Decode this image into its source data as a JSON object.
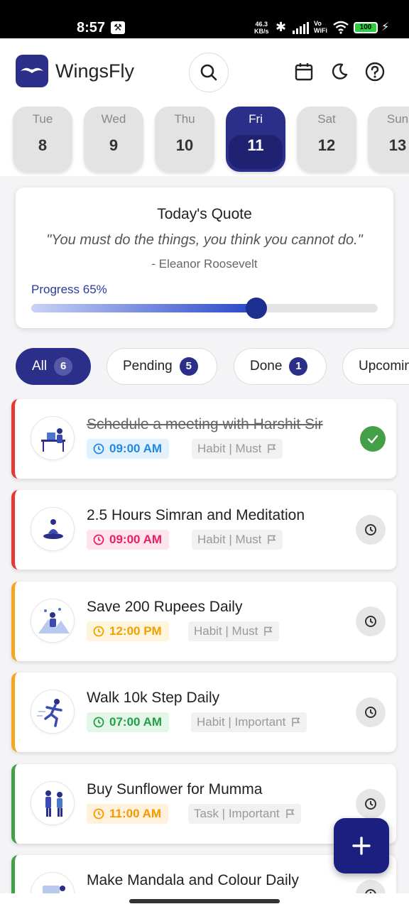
{
  "status_bar": {
    "time": "8:57",
    "speed_value": "46.3",
    "speed_unit": "KB/s",
    "vo": "Vo",
    "wifi_label": "WiFi",
    "battery": "100"
  },
  "header": {
    "app_name": "WingsFly"
  },
  "days": [
    {
      "name": "Tue",
      "num": "8"
    },
    {
      "name": "Wed",
      "num": "9"
    },
    {
      "name": "Thu",
      "num": "10"
    },
    {
      "name": "Fri",
      "num": "11",
      "active": true
    },
    {
      "name": "Sat",
      "num": "12"
    },
    {
      "name": "Sun",
      "num": "13"
    }
  ],
  "quote": {
    "title": "Today's Quote",
    "text": "\"You must do the things, you think you cannot do.\"",
    "author": "- Eleanor Roosevelt",
    "progress_label": "Progress 65%",
    "progress_value": 0.65
  },
  "filters": [
    {
      "label": "All",
      "count": "6",
      "active": true
    },
    {
      "label": "Pending",
      "count": "5"
    },
    {
      "label": "Done",
      "count": "1"
    },
    {
      "label": "Upcoming",
      "count": ""
    }
  ],
  "tasks": [
    {
      "title": "Schedule a meeting with Harshit Sir",
      "time": "09:00 AM",
      "tag": "Habit | Must",
      "done": true,
      "accent": "#e53935",
      "time_bg": "#e3f1fd",
      "time_fg": "#1e88e5"
    },
    {
      "title": "2.5 Hours Simran and Meditation",
      "time": "09:00 AM",
      "tag": "Habit | Must",
      "done": false,
      "accent": "#e53935",
      "time_bg": "#fde4ee",
      "time_fg": "#e91e63"
    },
    {
      "title": "Save 200 Rupees Daily",
      "time": "12:00 PM",
      "tag": "Habit | Must",
      "done": false,
      "accent": "#f5a623",
      "time_bg": "#fff5dc",
      "time_fg": "#f0a000"
    },
    {
      "title": "Walk 10k Step Daily",
      "time": "07:00 AM",
      "tag": "Habit | Important",
      "done": false,
      "accent": "#f5a623",
      "time_bg": "#e3f6e8",
      "time_fg": "#21a048"
    },
    {
      "title": "Buy Sunflower for Mumma",
      "time": "11:00 AM",
      "tag": "Task | Important",
      "done": false,
      "accent": "#43a047",
      "time_bg": "#fff1dc",
      "time_fg": "#f29a00"
    },
    {
      "title": "Make Mandala and Colour Daily",
      "time": "",
      "tag": "",
      "done": false,
      "accent": "#43a047",
      "time_bg": "#ffffff",
      "time_fg": "#333333"
    }
  ],
  "colors": {
    "primary": "#2b2f8a",
    "fab": "#1b2080"
  }
}
